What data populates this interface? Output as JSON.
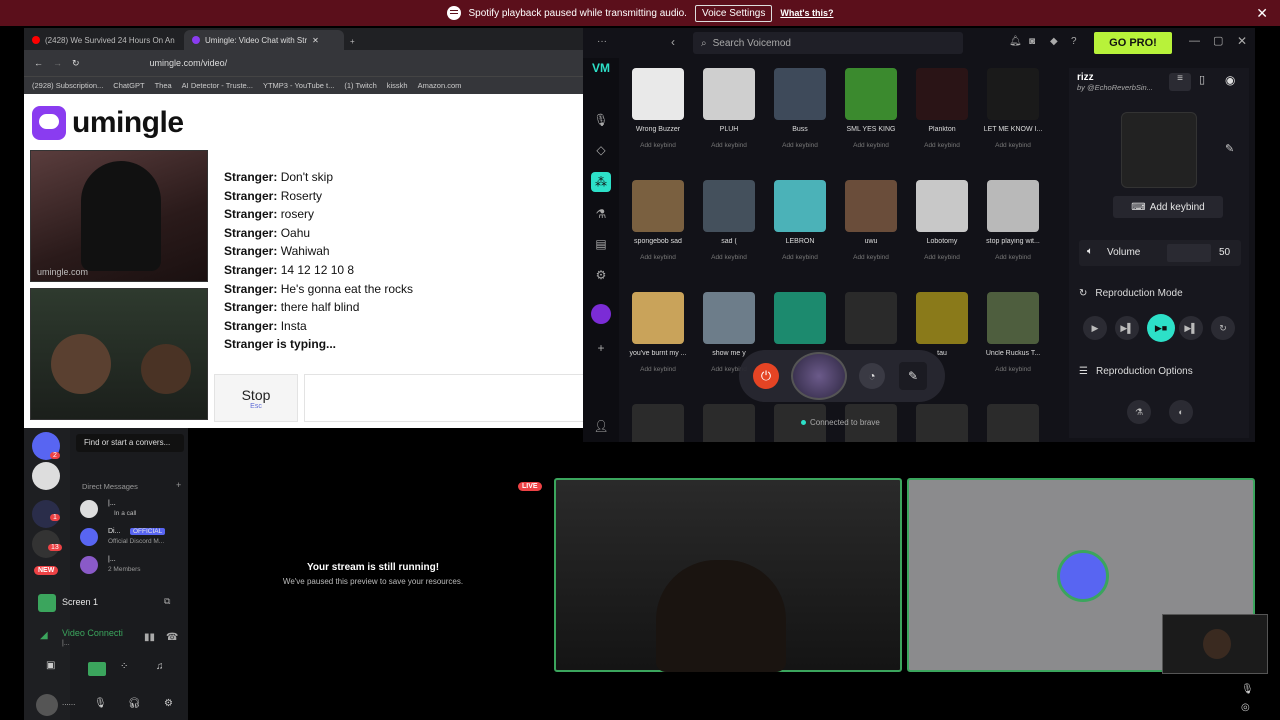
{
  "notification": {
    "text": "Spotify playback paused while transmitting audio.",
    "button": "Voice Settings",
    "link": "What's this?"
  },
  "browser": {
    "tabs": [
      {
        "label": "(2428) We Survived 24 Hours On An"
      },
      {
        "label": "Umingle: Video Chat with Str"
      }
    ],
    "url": "umingle.com/video/",
    "bookmarks": [
      "(2928) Subscription...",
      "ChatGPT",
      "Thea",
      "AI Detector - Truste...",
      "YTMP3 - YouTube t...",
      "(1) Twitch",
      "kisskh",
      "Amazon.com"
    ]
  },
  "umingle": {
    "logo": "umingle",
    "watermark": "umingle.com",
    "chat": [
      {
        "who": "Stranger:",
        "msg": "Don't skip"
      },
      {
        "who": "Stranger:",
        "msg": "Roserty"
      },
      {
        "who": "Stranger:",
        "msg": "rosery"
      },
      {
        "who": "Stranger:",
        "msg": "Oahu"
      },
      {
        "who": "Stranger:",
        "msg": "Wahiwah"
      },
      {
        "who": "Stranger:",
        "msg": "14 12 12 10 8"
      },
      {
        "who": "Stranger:",
        "msg": "He's gonna eat the rocks"
      },
      {
        "who": "Stranger:",
        "msg": "there half blind"
      },
      {
        "who": "Stranger:",
        "msg": "Insta"
      }
    ],
    "typing": "Stranger is typing...",
    "stop_label": "Stop",
    "stop_hint": "Esc"
  },
  "voicemod": {
    "search_placeholder": "Search Voicemod",
    "gopro": "GO PRO!",
    "sounds": [
      {
        "name": "Wrong Buzzer",
        "key": "Add keybind",
        "color": "#e9e9e9"
      },
      {
        "name": "PLUH",
        "key": "Add keybind",
        "color": "#cfcfcf"
      },
      {
        "name": "Buss",
        "key": "Add keybind",
        "color": "#3e4a5a"
      },
      {
        "name": "SML YES KING",
        "key": "Add keybind",
        "color": "#3b8a2e"
      },
      {
        "name": "Plankton",
        "key": "Add keybind",
        "color": "#2a1416"
      },
      {
        "name": "LET ME KNOW I...",
        "key": "Add keybind",
        "color": "#1a1a1a"
      },
      {
        "name": "spongebob sad",
        "key": "Add keybind",
        "color": "#7a6040"
      },
      {
        "name": "sad (",
        "key": "Add keybind",
        "color": "#44505c"
      },
      {
        "name": "LEBRON",
        "key": "Add keybind",
        "color": "#4bb2b8"
      },
      {
        "name": "uwu",
        "key": "Add keybind",
        "color": "#6a4d3a"
      },
      {
        "name": "Lobotomy",
        "key": "Add keybind",
        "color": "#c8c8c8"
      },
      {
        "name": "stop playing wit...",
        "key": "Add keybind",
        "color": "#b9b9b9"
      },
      {
        "name": "you've burnt my ...",
        "key": "Add keybind",
        "color": "#c9a35a"
      },
      {
        "name": "show me y",
        "key": "Add keybind",
        "color": "#6d7d8a"
      },
      {
        "name": "",
        "key": "",
        "color": "#1c8a6e"
      },
      {
        "name": "",
        "key": "",
        "color": "#2a2a2a"
      },
      {
        "name": "tau",
        "key": "",
        "color": "#8a7a1a"
      },
      {
        "name": "Uncle Ruckus T...",
        "key": "Add keybind",
        "color": "#4e5e3e"
      }
    ],
    "status": "Connected to brave",
    "panel": {
      "title": "rizz",
      "author": "by @EchoReverbSin...",
      "add_keybind": "Add keybind",
      "volume_label": "Volume",
      "volume_value": "50",
      "mode_label": "Reproduction Mode",
      "options_label": "Reproduction Options"
    },
    "accent": "#b8f23a"
  },
  "discord": {
    "search": "Find or start a convers...",
    "dm_header": "Direct Messages",
    "dms": [
      {
        "name": "|...",
        "sub": "In a call"
      },
      {
        "name": "Di...",
        "badge": "OFFICIAL",
        "sub": "Official Discord M..."
      },
      {
        "name": "|...",
        "sub": "2 Members"
      }
    ],
    "new_badge": "NEW",
    "screen_label": "Screen 1",
    "video_connected": "Video Connecti",
    "video_sub": "|...",
    "stream_title": "Your stream is still running!",
    "stream_sub": "We've paused this preview to save your resources.",
    "live": "LIVE",
    "user_short": "......",
    "server_badges": [
      "2",
      "1",
      "13"
    ]
  }
}
